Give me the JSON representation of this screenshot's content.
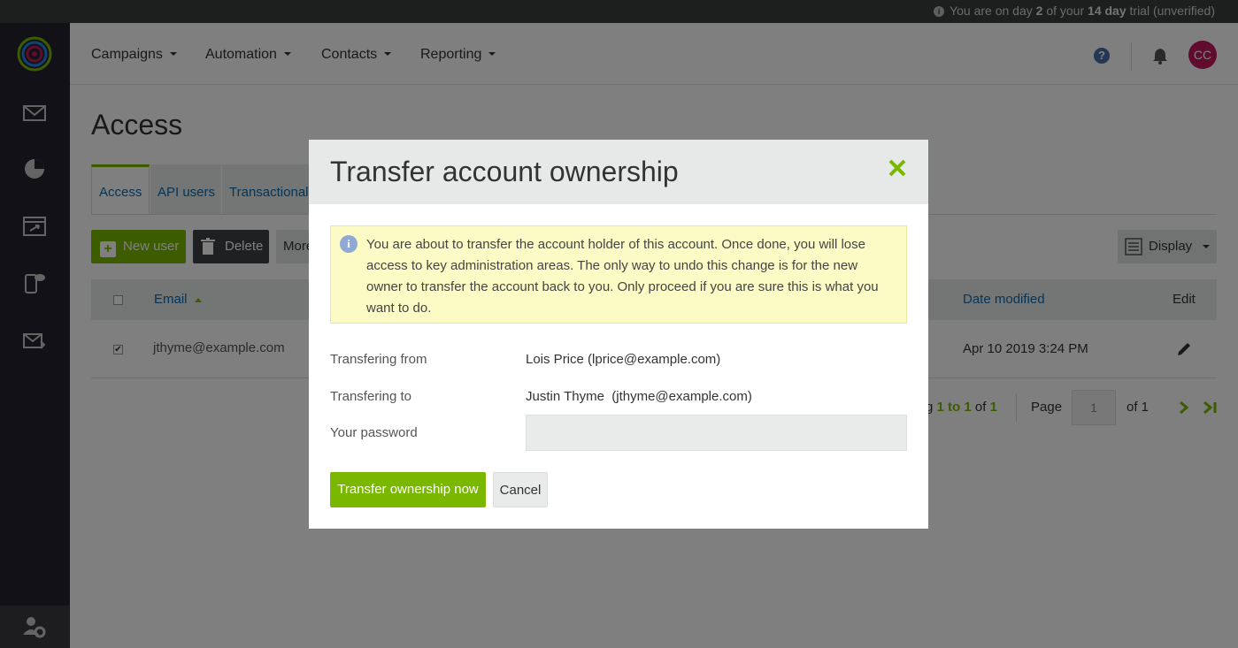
{
  "trial_bar": {
    "prefix": "You are on day ",
    "day": "2",
    "middle": " of your ",
    "length": "14 day",
    "suffix": " trial (unverified)"
  },
  "nav": {
    "items": [
      {
        "label": "Campaigns"
      },
      {
        "label": "Automation"
      },
      {
        "label": "Contacts"
      },
      {
        "label": "Reporting"
      }
    ],
    "help_icon": "?",
    "avatar_initials": "CC"
  },
  "page": {
    "title": "Access",
    "tabs": [
      {
        "label": "Access",
        "active": true
      },
      {
        "label": "API users",
        "active": false
      },
      {
        "label": "Transactional",
        "active": false
      }
    ],
    "toolbar": {
      "new_user": "New user",
      "delete": "Delete",
      "more": "More",
      "display": "Display"
    },
    "table": {
      "headers": {
        "email": "Email",
        "date_modified": "Date modified",
        "edit": "Edit"
      },
      "rows": [
        {
          "checked": true,
          "email": "jthyme@example.com",
          "date_modified": "Apr 10 2019 3:24 PM"
        }
      ]
    },
    "pagination": {
      "showing_prefix": "g ",
      "range": "1 to 1",
      "of_label": " of ",
      "total": "1",
      "page_label": "Page",
      "page_value": "1",
      "of_pages": "of 1"
    }
  },
  "modal": {
    "title": "Transfer account ownership",
    "alert": "You are about to transfer the account holder of this account. Once done, you will lose access to key administration areas. The only way to undo this change is for the new owner to transfer the account back to you. Only proceed if you are sure this is what you want to do.",
    "from_label": "Transfering from",
    "from_value": "Lois Price (lprice@example.com)",
    "to_label": "Transfering to",
    "to_value": "Justin Thyme  (jthyme@example.com)",
    "password_label": "Your password",
    "password_value": "",
    "submit": "Transfer ownership now",
    "cancel": "Cancel"
  },
  "colors": {
    "accent": "#7ab800",
    "link": "#0b6ab0",
    "sidebar": "#23232e",
    "avatar": "#c2185b"
  }
}
